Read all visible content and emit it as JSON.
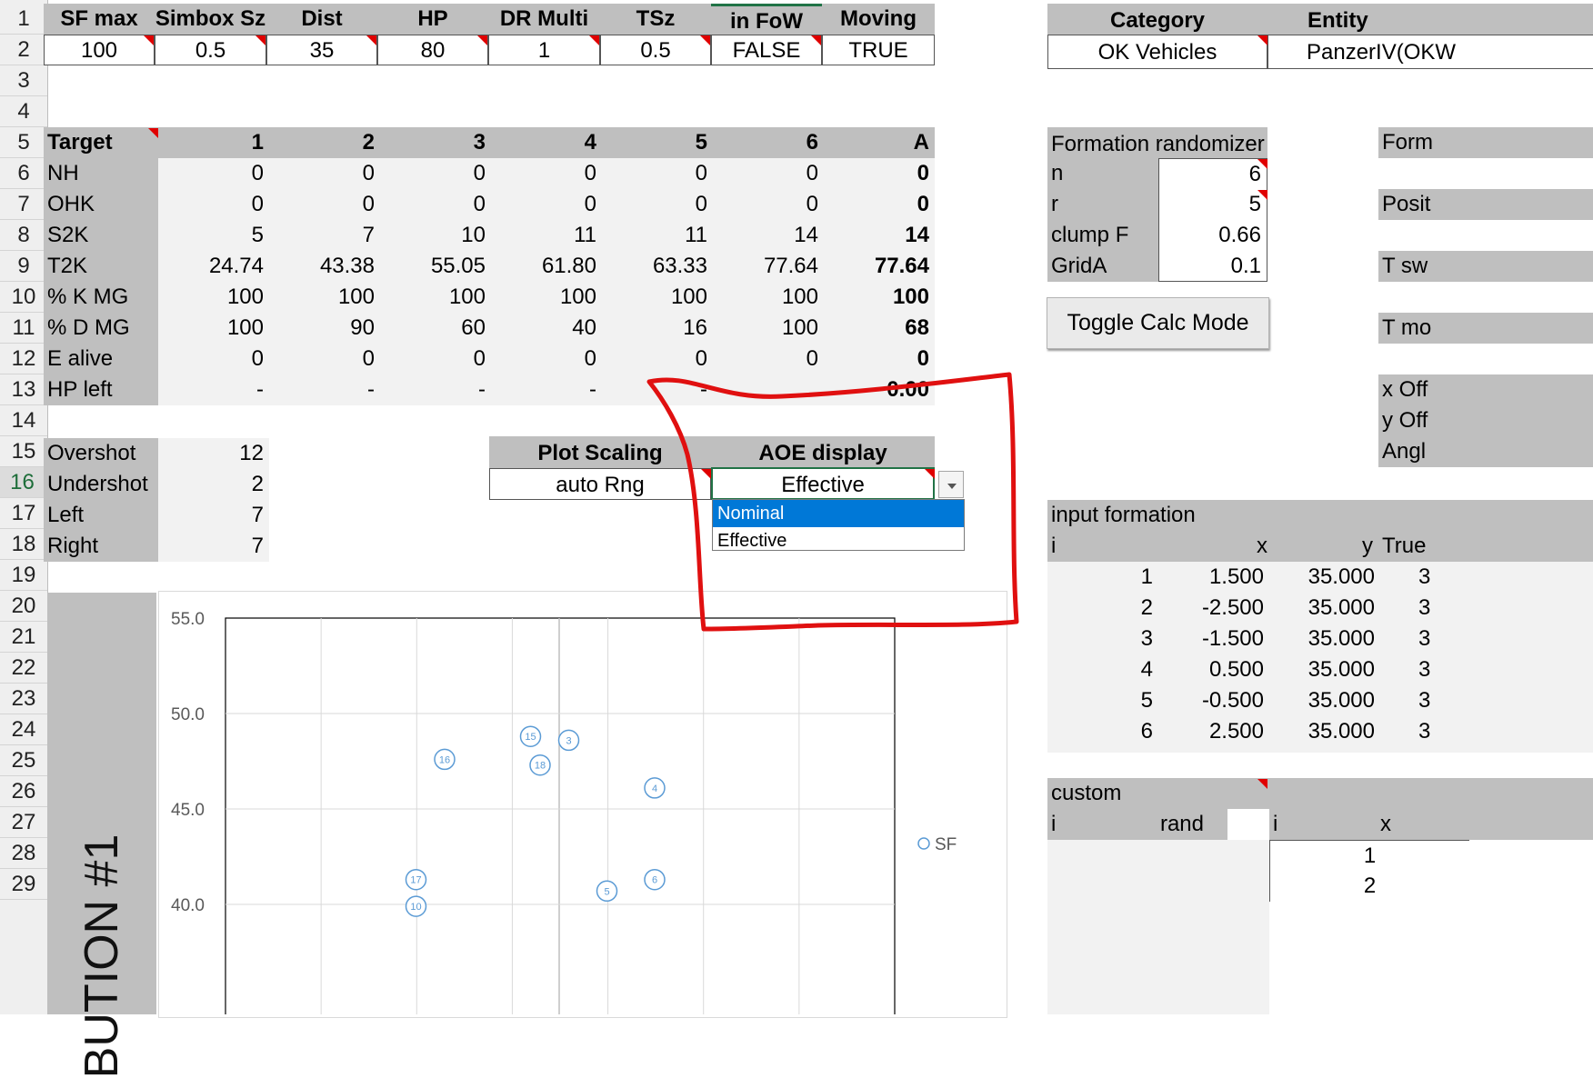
{
  "row_numbers": [
    "1",
    "2",
    "3",
    "4",
    "5",
    "6",
    "7",
    "8",
    "9",
    "10",
    "11",
    "12",
    "13",
    "14",
    "15",
    "16",
    "17",
    "18",
    "19",
    "20",
    "21",
    "22",
    "23",
    "24",
    "25",
    "26",
    "27",
    "28",
    "29"
  ],
  "params": {
    "headers": [
      "SF max",
      "Simbox Sz",
      "Dist",
      "HP",
      "DR Multi",
      "TSz",
      "in FoW",
      "Moving"
    ],
    "values": [
      "100",
      "0.5",
      "35",
      "80",
      "1",
      "0.5",
      "FALSE",
      "TRUE"
    ]
  },
  "category": {
    "header": "Category",
    "value": "OK Vehicles"
  },
  "entity": {
    "header": "Entity",
    "value": "PanzerIV(OKW"
  },
  "target_table": {
    "corner": "Target",
    "columns": [
      "1",
      "2",
      "3",
      "4",
      "5",
      "6",
      "A"
    ],
    "rows": [
      {
        "label": "NH",
        "values": [
          "0",
          "0",
          "0",
          "0",
          "0",
          "0",
          "0"
        ]
      },
      {
        "label": "OHK",
        "values": [
          "0",
          "0",
          "0",
          "0",
          "0",
          "0",
          "0"
        ]
      },
      {
        "label": "S2K",
        "values": [
          "5",
          "7",
          "10",
          "11",
          "11",
          "14",
          "14"
        ]
      },
      {
        "label": "T2K",
        "values": [
          "24.74",
          "43.38",
          "55.05",
          "61.80",
          "63.33",
          "77.64",
          "77.64"
        ]
      },
      {
        "label": "% K MG",
        "values": [
          "100",
          "100",
          "100",
          "100",
          "100",
          "100",
          "100"
        ]
      },
      {
        "label": "% D MG",
        "values": [
          "100",
          "90",
          "60",
          "40",
          "16",
          "100",
          "68"
        ]
      },
      {
        "label": "E alive",
        "values": [
          "0",
          "0",
          "0",
          "0",
          "0",
          "0",
          "0"
        ]
      },
      {
        "label": "HP left",
        "values": [
          "-",
          "-",
          "-",
          "-",
          "-",
          "",
          "0.00"
        ]
      }
    ]
  },
  "shots": [
    {
      "label": "Overshot",
      "value": "12"
    },
    {
      "label": "Undershot",
      "value": "2"
    },
    {
      "label": "Left",
      "value": "7"
    },
    {
      "label": "Right",
      "value": "7"
    }
  ],
  "plot_scaling": {
    "header": "Plot Scaling",
    "value": "auto Rng"
  },
  "aoe_display": {
    "header": "AOE display",
    "value": "Effective",
    "options": [
      "Nominal",
      "Effective"
    ],
    "highlighted": "Nominal"
  },
  "formation_randomizer": {
    "title": "Formation randomizer",
    "rows": [
      {
        "label": "n",
        "value": "6"
      },
      {
        "label": "r",
        "value": "5"
      },
      {
        "label": "clump F",
        "value": "0.66"
      },
      {
        "label": "GridA",
        "value": "0.1"
      }
    ]
  },
  "toggle_button": "Toggle Calc Mode",
  "right_edge_labels": [
    "Form",
    "Posit",
    "T sw",
    "T mo",
    "x Off",
    "y Off",
    "Angl"
  ],
  "input_formation": {
    "title": "input formation",
    "headers": [
      "i",
      "x",
      "y",
      "True"
    ],
    "rows": [
      {
        "i": "1",
        "x": "1.500",
        "y": "35.000",
        "t": "3"
      },
      {
        "i": "2",
        "x": "-2.500",
        "y": "35.000",
        "t": "3"
      },
      {
        "i": "3",
        "x": "-1.500",
        "y": "35.000",
        "t": "3"
      },
      {
        "i": "4",
        "x": "0.500",
        "y": "35.000",
        "t": "3"
      },
      {
        "i": "5",
        "x": "-0.500",
        "y": "35.000",
        "t": "3"
      },
      {
        "i": "6",
        "x": "2.500",
        "y": "35.000",
        "t": "3"
      }
    ]
  },
  "custom": {
    "title": "custom",
    "headers": [
      "i",
      "rand",
      "i",
      "x"
    ],
    "rows": [
      "1",
      "2"
    ]
  },
  "side_title": "BUTION #1",
  "colors": {
    "header_gray": "#bfbfbf",
    "light_gray": "#f2f2f2",
    "selection_green": "#217346",
    "highlight_blue": "#0078d7",
    "marker_blue": "#5b9bd5",
    "annotation_red": "#e01010"
  },
  "chart_data": {
    "type": "scatter",
    "ylim": [
      40,
      55
    ],
    "yticks": [
      "55.0",
      "50.0",
      "45.0",
      "40.0"
    ],
    "series": [
      {
        "name": "SF",
        "points": [
          {
            "label": "15",
            "x": -0.3,
            "y": 48.8
          },
          {
            "label": "3",
            "x": 0.1,
            "y": 48.6
          },
          {
            "label": "16",
            "x": -1.2,
            "y": 47.6
          },
          {
            "label": "18",
            "x": -0.2,
            "y": 47.3
          },
          {
            "label": "4",
            "x": 1.0,
            "y": 46.1
          },
          {
            "label": "17",
            "x": -1.5,
            "y": 41.3
          },
          {
            "label": "6",
            "x": 1.0,
            "y": 41.3
          },
          {
            "label": "5",
            "x": 0.5,
            "y": 40.7
          },
          {
            "label": "10",
            "x": -1.5,
            "y": 39.9
          }
        ]
      }
    ],
    "legend": "right"
  }
}
